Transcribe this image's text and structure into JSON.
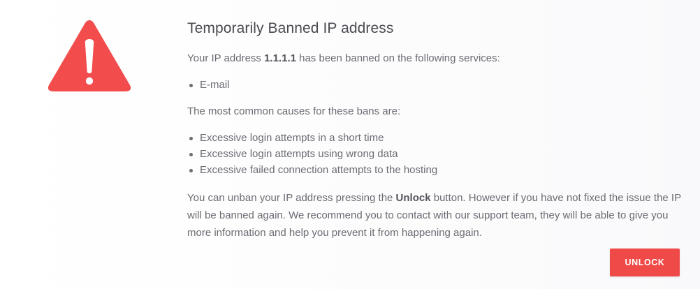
{
  "title": "Temporarily Banned IP address",
  "intro": {
    "prefix": "Your IP address ",
    "ip": "1.1.1.1",
    "suffix": " has been banned on the following services:"
  },
  "services": [
    "E-mail"
  ],
  "causes_intro": "The most common causes for these bans are:",
  "causes": [
    "Excessive login attempts in a short time",
    "Excessive login attempts using wrong data",
    "Excessive failed connection attempts to the hosting"
  ],
  "explanation": {
    "prefix": "You can unban your IP address pressing the ",
    "button_ref": "Unlock",
    "suffix": " button. However if you have not fixed the issue the IP will be banned again. We recommend you to contact with our support team, they will be able to give you more information and help you prevent it from happening again."
  },
  "unlock_button": "UNLOCK",
  "colors": {
    "warning_red": "#f24c4c",
    "button_red": "#ef4a47",
    "text": "#6b6c73"
  },
  "icons": {
    "warning": "warning-triangle-icon"
  }
}
